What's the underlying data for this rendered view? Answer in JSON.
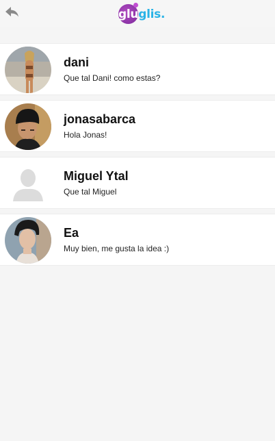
{
  "header": {
    "back_icon": "back-arrow-icon",
    "logo": {
      "part1": "glu",
      "part2": "glis."
    },
    "colors": {
      "logo_purple": "#9a3bb5",
      "logo_blue": "#2bb3e6"
    }
  },
  "conversations": [
    {
      "name": "dani",
      "message": "Que tal Dani! como estas?",
      "avatar": "beach-photo"
    },
    {
      "name": "jonasabarca",
      "message": "Hola Jonas!",
      "avatar": "beanie-photo"
    },
    {
      "name": "Miguel Ytal",
      "message": "Que tal Miguel",
      "avatar": "default-user-icon"
    },
    {
      "name": "Ea",
      "message": "Muy bien, me gusta la idea :)",
      "avatar": "portrait-photo"
    }
  ]
}
